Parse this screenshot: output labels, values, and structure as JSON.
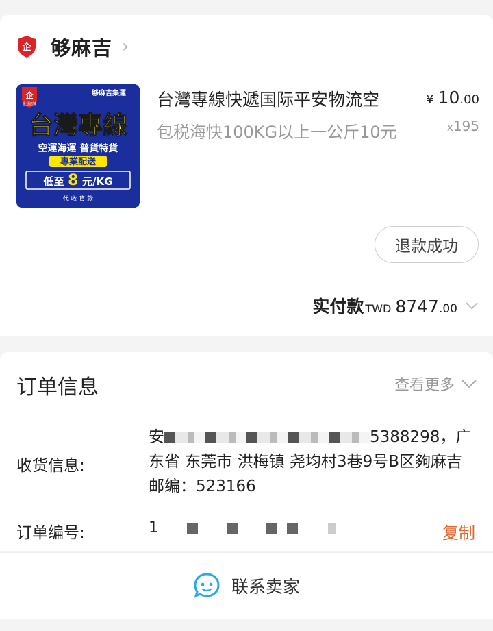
{
  "shop": {
    "name": "够麻吉",
    "badge_icon": "shop-badge-icon"
  },
  "product": {
    "title": "台灣專線快遞国际平安物流空",
    "description": "包税海快100KG以上一公斤10元",
    "price_currency": "¥",
    "price_int": "10",
    "price_dec": ".00",
    "qty_prefix": "x",
    "qty": "195",
    "image": {
      "brand": "够麻吉集運",
      "badge": "企业店铺",
      "headline": "台灣專線",
      "line1": "空運海運  普貨特貨",
      "line2": "專業配送",
      "line3_prefix": "低至",
      "line3_big": "8",
      "line3_suffix": "元/KG",
      "line4": "代 收 貨 款"
    }
  },
  "refund_button": "退款成功",
  "payment": {
    "label": "实付款",
    "currency": "TWD",
    "amount_int": "8747",
    "amount_dec": ".00"
  },
  "order_info": {
    "title": "订单信息",
    "more_label": "查看更多",
    "address_label": "收货信息:",
    "address_visible_start": "安",
    "address_visible_phone_tail": "5388298，广东省 东莞市 洪梅镇 尧均村3巷9号B区夠麻吉 邮编：523166",
    "order_no_label": "订单编号:",
    "order_no_visible": "1",
    "copy_label": "复制"
  },
  "contact": {
    "label": "联系卖家"
  },
  "colors": {
    "accent_orange": "#e0652a",
    "contact_blue": "#29a9e8",
    "badge_red": "#d9252a",
    "product_blue": "#1a2e9e",
    "product_yellow": "#ffe600"
  }
}
